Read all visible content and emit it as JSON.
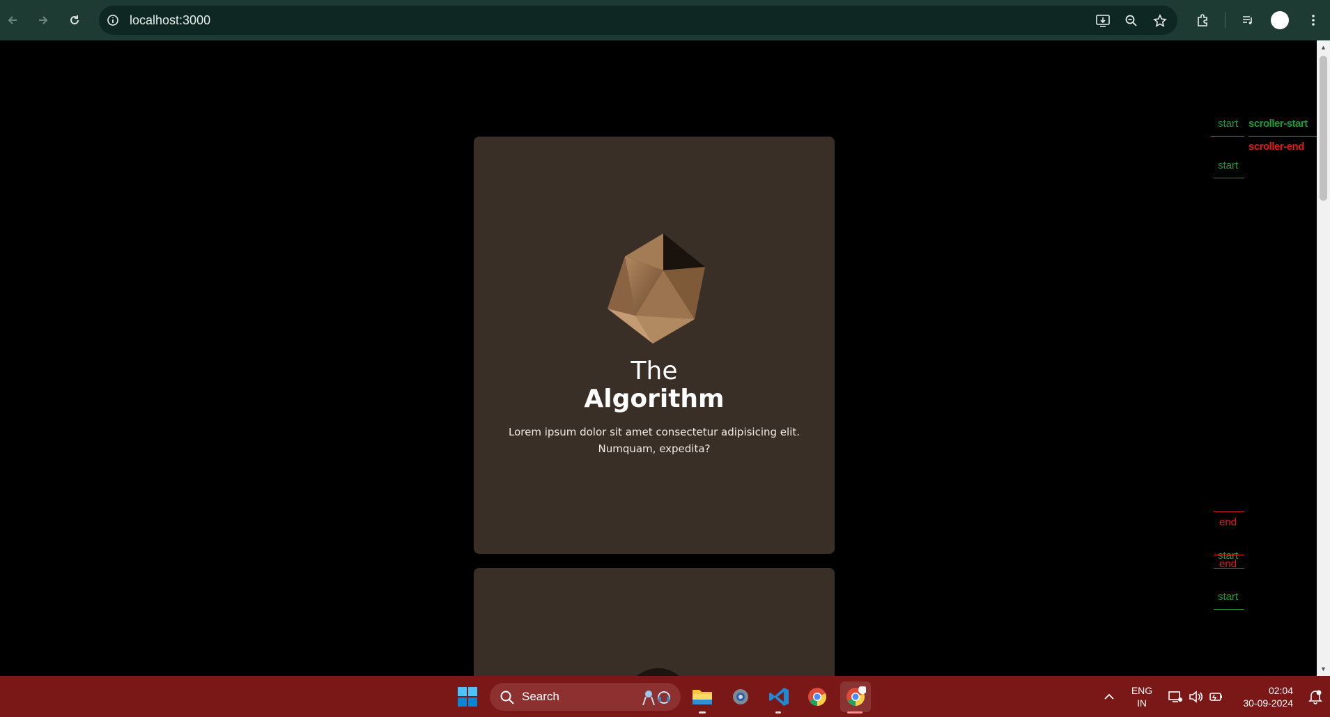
{
  "browser": {
    "url": "localhost:3000",
    "icons": [
      "back-icon",
      "forward-icon",
      "reload-icon",
      "site-info-icon",
      "install-app-icon",
      "zoom-icon",
      "bookmark-star-icon",
      "extensions-icon",
      "media-control-icon",
      "profile-avatar",
      "more-menu-icon"
    ]
  },
  "card": {
    "title_light": "The",
    "title_bold": "Algorithm",
    "description": "Lorem ipsum dolor sit amet consectetur adipisicing elit. Numquam, expedita?"
  },
  "markers": {
    "start_1": "start",
    "scroller_start": "scroller-start",
    "scroller_end": "scroller-end",
    "start_2": "start",
    "end_1": "end",
    "start_3": "start",
    "end_2": "end",
    "start_4": "start",
    "colors": {
      "start": "#1f9a33",
      "end": "#e01b1b"
    }
  },
  "taskbar": {
    "search_label": "Search",
    "lang_top": "ENG",
    "lang_bottom": "IN",
    "time": "02:04",
    "date": "30-09-2024",
    "icons": [
      "windows-start-icon",
      "search-icon",
      "file-explorer-icon",
      "settings-icon",
      "vscode-icon",
      "chrome-icon",
      "chrome-active-icon",
      "tray-chevron-icon",
      "network-icon",
      "volume-icon",
      "battery-icon",
      "notification-icon"
    ],
    "accent": "#7a1717"
  }
}
